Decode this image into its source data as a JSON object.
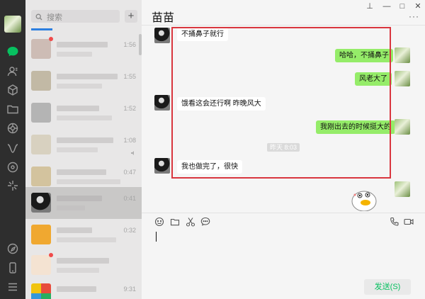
{
  "search": {
    "placeholder": "搜索"
  },
  "list": {
    "add_label": "+",
    "conversations": [
      {
        "time": "1:56",
        "unread": true
      },
      {
        "time": "1:55",
        "unread": false
      },
      {
        "time": "1:52",
        "unread": false
      },
      {
        "time": "1:08",
        "unread": false
      },
      {
        "time": "0:47",
        "unread": false
      },
      {
        "time": "0:41",
        "unread": false,
        "selected": true
      },
      {
        "time": "0:32",
        "unread": false
      },
      {
        "time": "",
        "unread": true
      },
      {
        "time": "9:31",
        "unread": false
      }
    ]
  },
  "chat": {
    "title": "苗苗",
    "more": "···",
    "system_time": "昨天 8:03",
    "messages": [
      {
        "from": "friend",
        "text": "不捅鼻子就行"
      },
      {
        "from": "me",
        "text": "哈哈，不捅鼻子"
      },
      {
        "from": "me",
        "text": "风老大了"
      },
      {
        "from": "friend",
        "text": "饿看这会还行啊 昨晚风大"
      },
      {
        "from": "me",
        "text": "我刚出去的时候挺大的"
      },
      {
        "from": "friend",
        "text": "我也做完了，很快"
      }
    ],
    "send_label": "发送(S)"
  },
  "colors": {
    "accent": "#07c160",
    "bubble_out": "#95ec69",
    "highlight_box": "#d9363e"
  }
}
